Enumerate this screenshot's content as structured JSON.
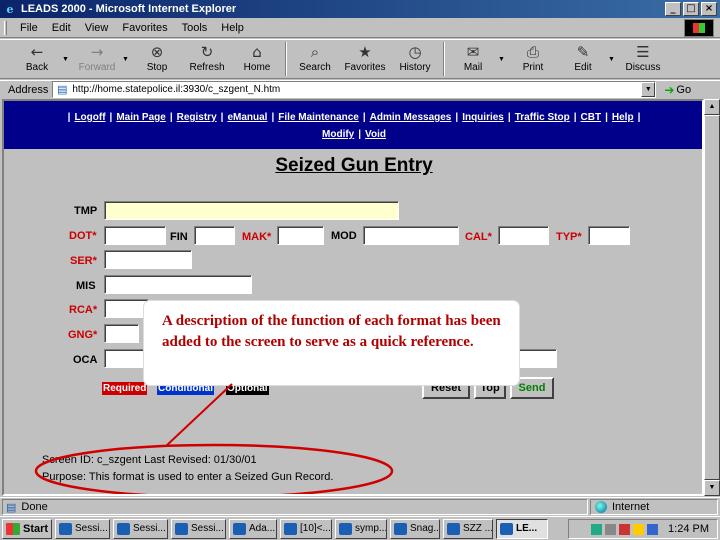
{
  "window": {
    "title": "LEADS 2000 - Microsoft Internet Explorer",
    "buttons": [
      "_",
      "□",
      "×"
    ]
  },
  "menu": [
    {
      "label": "File"
    },
    {
      "label": "Edit"
    },
    {
      "label": "View"
    },
    {
      "label": "Favorites"
    },
    {
      "label": "Tools"
    },
    {
      "label": "Help"
    }
  ],
  "toolbar": [
    {
      "label": "Back",
      "icon": "←",
      "icon_name": "back-arrow-icon",
      "enabled": true,
      "dropdown": true
    },
    {
      "label": "Forward",
      "icon": "→",
      "icon_name": "forward-arrow-icon",
      "enabled": false,
      "dropdown": true
    },
    {
      "label": "Stop",
      "icon": "⊗",
      "icon_name": "stop-icon",
      "enabled": true
    },
    {
      "label": "Refresh",
      "icon": "↻",
      "icon_name": "refresh-icon",
      "enabled": true
    },
    {
      "label": "Home",
      "icon": "⌂",
      "icon_name": "home-icon",
      "enabled": true
    },
    {
      "label": "Search",
      "icon": "⌕",
      "icon_name": "search-icon",
      "enabled": true
    },
    {
      "label": "Favorites",
      "icon": "★",
      "icon_name": "favorites-icon",
      "enabled": true
    },
    {
      "label": "History",
      "icon": "◷",
      "icon_name": "history-icon",
      "enabled": true
    },
    {
      "label": "Mail",
      "icon": "✉",
      "icon_name": "mail-icon",
      "enabled": true,
      "dropdown": true
    },
    {
      "label": "Print",
      "icon": "⎙",
      "icon_name": "print-icon",
      "enabled": true
    },
    {
      "label": "Edit",
      "icon": "✎",
      "icon_name": "edit-icon",
      "enabled": true,
      "dropdown": true
    },
    {
      "label": "Discuss",
      "icon": "☰",
      "icon_name": "discuss-icon",
      "enabled": true
    }
  ],
  "address": {
    "label": "Address",
    "url": "http://home.statepolice.il:3930/c_szgent_N.htm",
    "go_label": "Go"
  },
  "nav_links_row1": [
    "Logoff",
    "Main Page",
    "Registry",
    "eManual",
    "File Maintenance",
    "Admin Messages",
    "Inquiries",
    "Traffic Stop",
    "CBT",
    "Help"
  ],
  "nav_links_row2": [
    "Modify",
    "Void"
  ],
  "form": {
    "title": "Seized Gun Entry",
    "labels": {
      "tmp": "TMP",
      "dot": "DOT*",
      "fin": "FIN",
      "mak": "MAK*",
      "mod": "MOD",
      "cal": "CAL*",
      "typ": "TYP*",
      "ser": "SER*",
      "mis": "MIS",
      "rca": "RCA*",
      "gng": "GNG*",
      "oca": "OCA"
    },
    "legend": {
      "required": "Required",
      "conditional": "Conditional",
      "optional": "Optional",
      "required_color": "#cc0000",
      "conditional_color": "#0033cc",
      "optional_color": "#000000"
    },
    "buttons": {
      "reset": "Reset",
      "top": "Top",
      "send": "Send"
    },
    "screen_id_line": "Screen ID:  c_szgent    Last Revised: 01/30/01",
    "purpose_line": "Purpose: This format is used to enter a Seized Gun Record."
  },
  "callout": {
    "text": "A description of the function of each format has been added to the screen to serve as a quick reference.",
    "color": "#b00000"
  },
  "status": {
    "text": "Done",
    "zone": "Internet"
  },
  "taskbar": {
    "start_label": "Start",
    "tasks": [
      {
        "label": "Sessi..."
      },
      {
        "label": "Sessi..."
      },
      {
        "label": "Sessi..."
      },
      {
        "label": "Ada..."
      },
      {
        "label": "[10]<..."
      },
      {
        "label": "symp..."
      },
      {
        "label": "Snag..."
      },
      {
        "label": "SZZ ..."
      },
      {
        "label": "LE...",
        "active": true
      }
    ],
    "clock": "1:24 PM"
  }
}
